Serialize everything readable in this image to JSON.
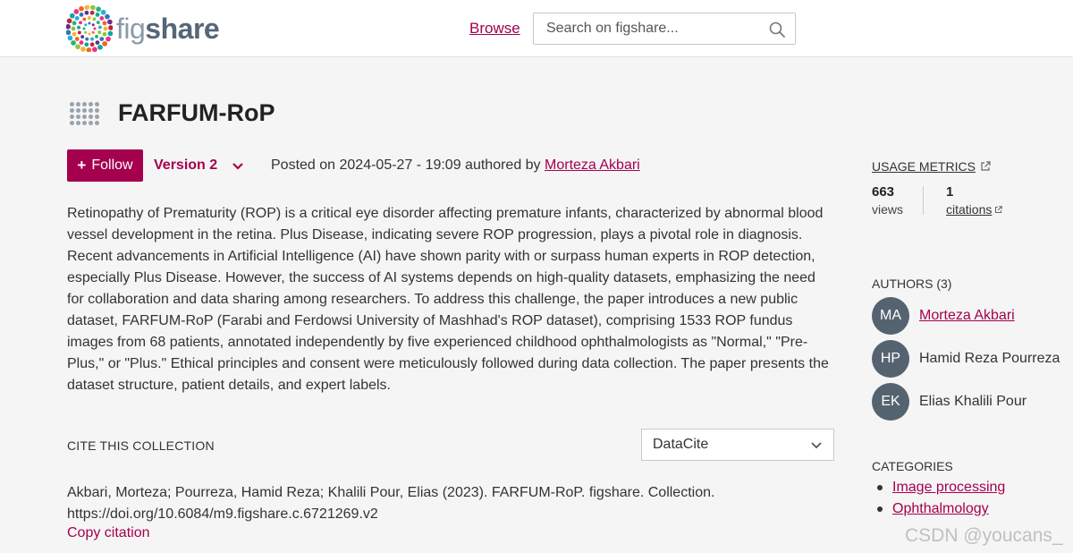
{
  "header": {
    "logo_fig": "fig",
    "logo_share": "share",
    "browse_label": "Browse",
    "search_placeholder": "Search on figshare..."
  },
  "item": {
    "title": "FARFUM-RoP",
    "follow_label": "Follow",
    "version_label": "Version 2",
    "posted_prefix": "Posted on 2024-05-27 - 19:09 authored by",
    "posted_author": "Morteza Akbari",
    "description": "Retinopathy of Prematurity (ROP) is a critical eye disorder affecting premature infants, characterized by abnormal blood vessel development in the retina. Plus Disease, indicating severe ROP progression, plays a pivotal role in diagnosis. Recent advancements in Artificial Intelligence (AI) have shown parity with or surpass human experts in ROP detection, especially Plus Disease. However, the success of AI systems depends on high-quality datasets, emphasizing the need for collaboration and data sharing among researchers. To address this challenge, the paper introduces a new public dataset, FARFUM-RoP (Farabi and Ferdowsi University of Mashhad's ROP dataset), comprising 1533 ROP fundus images from 68 patients, annotated independently by five experienced childhood ophthalmologists as \"Normal,\" \"Pre-Plus,\" or \"Plus.\" Ethical principles and consent were meticulously followed during data collection. The paper presents the dataset structure, patient details, and expert labels."
  },
  "cite": {
    "label": "CITE THIS COLLECTION",
    "style_selected": "DataCite",
    "citation_line1": "Akbari, Morteza; Pourreza, Hamid Reza; Khalili Pour, Elias (2023). FARFUM-RoP. figshare. Collection.",
    "citation_line2": "https://doi.org/10.6084/m9.figshare.c.6721269.v2",
    "copy_label": "Copy citation"
  },
  "metrics": {
    "heading": "USAGE METRICS",
    "views_value": "663",
    "views_label": "views",
    "citations_value": "1",
    "citations_label": "citations"
  },
  "authors": {
    "heading": "AUTHORS (3)",
    "list": [
      {
        "initials": "MA",
        "name": "Morteza Akbari"
      },
      {
        "initials": "HP",
        "name": "Hamid Reza Pourreza"
      },
      {
        "initials": "EK",
        "name": "Elias Khalili Pour"
      }
    ]
  },
  "categories": {
    "heading": "CATEGORIES",
    "items": [
      "Image processing",
      "Ophthalmology"
    ]
  },
  "watermark": "CSDN @youcans_",
  "colors": {
    "accent": "#a5004e",
    "avatar_bg": "#556370",
    "page_bg": "#f5f5f5"
  }
}
